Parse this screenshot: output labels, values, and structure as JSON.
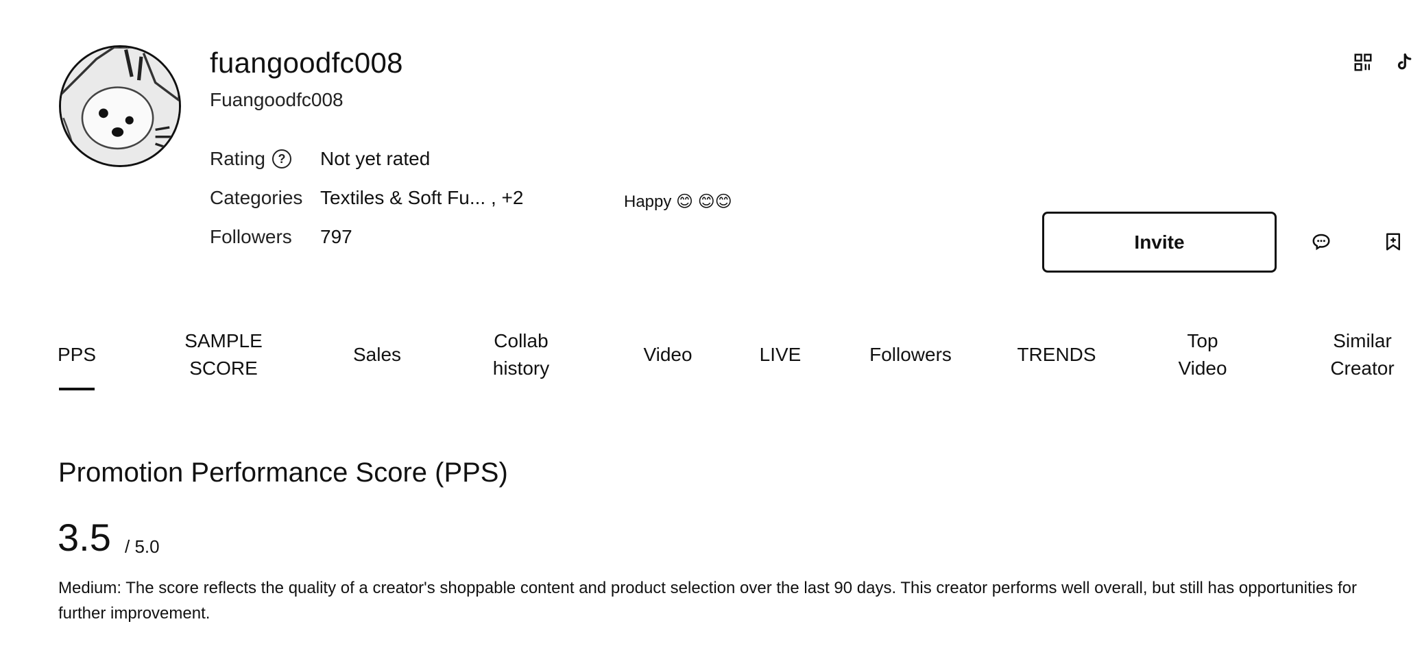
{
  "profile": {
    "username": "fuangoodfc008",
    "nickname": "Fuangoodfc008",
    "bio": "Happy 😊 😊😊"
  },
  "info": {
    "rating_label": "Rating",
    "rating_value": "Not yet rated",
    "categories_label": "Categories",
    "categories_value": "Textiles & Soft Fu... , +2",
    "followers_label": "Followers",
    "followers_value": "797"
  },
  "icons": {
    "help": "question-circle-icon",
    "qr": "qr-code-icon",
    "tiktok": "tiktok-logo-icon",
    "message": "chat-bubble-icon",
    "bookmark": "bookmark-add-icon"
  },
  "actions": {
    "invite_label": "Invite"
  },
  "tabs": [
    {
      "label": "PPS",
      "active": true
    },
    {
      "label": "SAMPLE SCORE"
    },
    {
      "label": "Sales"
    },
    {
      "label": "Collab history"
    },
    {
      "label": "Video"
    },
    {
      "label": "LIVE"
    },
    {
      "label": "Followers"
    },
    {
      "label": "TRENDS"
    },
    {
      "label": "Top Video"
    },
    {
      "label": "Similar Creator"
    }
  ],
  "pps": {
    "title": "Promotion Performance Score (PPS)",
    "score": "3.5",
    "max": "/ 5.0",
    "level": "Medium",
    "description": ": The score reflects the quality of a creator's shoppable content and product selection over the last 90 days. This creator performs well overall, but still has opportunities for further improvement."
  },
  "colors": {
    "text": "#111111",
    "background": "#ffffff"
  }
}
